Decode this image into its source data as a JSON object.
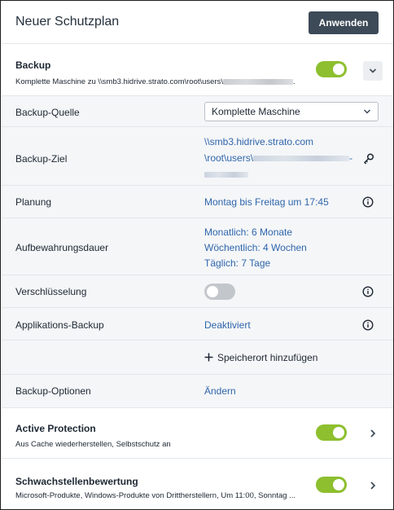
{
  "header": {
    "title": "Neuer Schutzplan",
    "apply_label": "Anwenden"
  },
  "backup": {
    "title": "Backup",
    "subtitle": "Komplette Maschine zu \\\\smb3.hidrive.strato.com\\root\\users\\",
    "subtitle_suffix": ".",
    "enabled": true
  },
  "details": {
    "source": {
      "label": "Backup-Quelle",
      "value": "Komplette Maschine"
    },
    "target": {
      "label": "Backup-Ziel",
      "line1": "\\\\smb3.hidrive.strato.com",
      "line2": "\\root\\users\\",
      "line2_suffix": "-"
    },
    "schedule": {
      "label": "Planung",
      "value": "Montag bis Freitag um 17:45"
    },
    "retention": {
      "label": "Aufbewahrungsdauer",
      "monthly": "Monatlich: 6 Monate",
      "weekly": "Wöchentlich: 4 Wochen",
      "daily": "Täglich: 7 Tage"
    },
    "encryption": {
      "label": "Verschlüsselung",
      "enabled": false
    },
    "app_backup": {
      "label": "Applikations-Backup",
      "value": "Deaktiviert"
    },
    "add_location": {
      "label": "Speicherort hinzufügen"
    },
    "options": {
      "label": "Backup-Optionen",
      "value": "Ändern"
    }
  },
  "active_protection": {
    "title": "Active Protection",
    "subtitle": "Aus Cache wiederherstellen, Selbstschutz an",
    "enabled": true
  },
  "vulnerability": {
    "title": "Schwachstellenbewertung",
    "subtitle": "Microsoft-Produkte, Windows-Produkte von Drittherstellern, Um 11:00, Sonntag ...",
    "enabled": true
  },
  "colors": {
    "accent_toggle": "#8dbf2e",
    "link": "#2f66ab",
    "primary_button": "#3d4a57"
  },
  "icons": {
    "collapse": "chevron-down-icon",
    "expand": "chevron-right-icon",
    "info": "info-icon",
    "credentials": "key-icon",
    "add": "plus-icon"
  }
}
